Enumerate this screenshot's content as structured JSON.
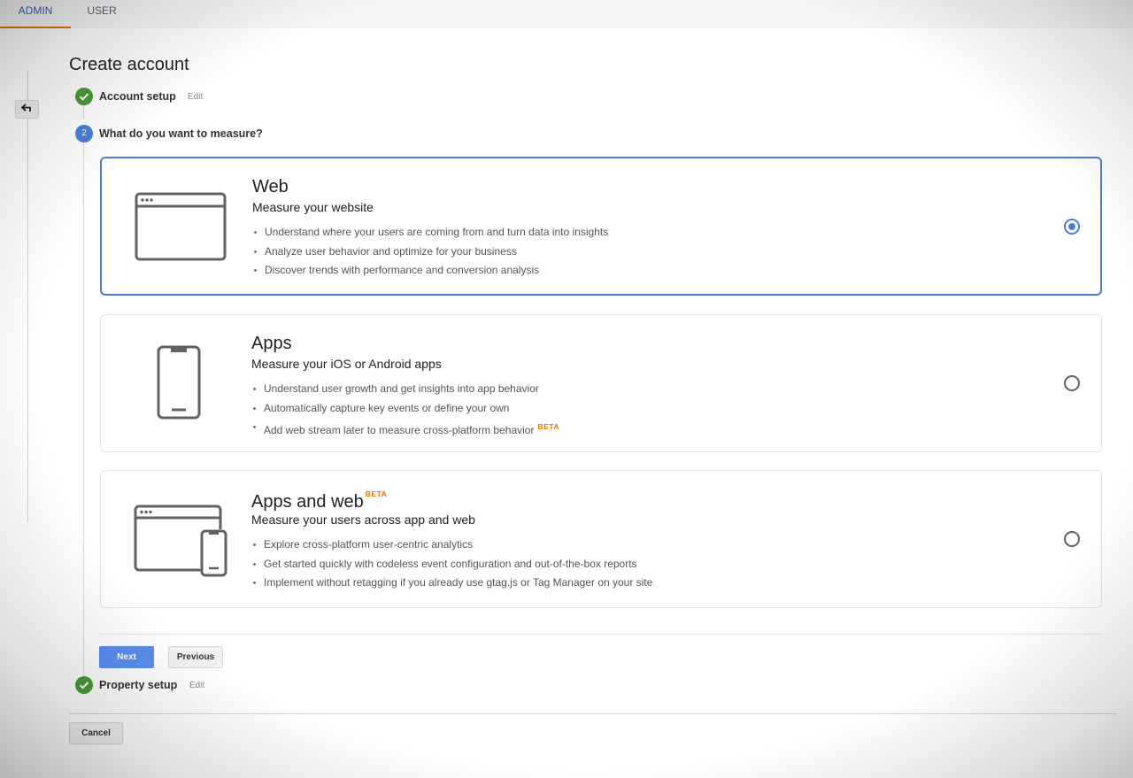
{
  "tabs": [
    {
      "label": "ADMIN",
      "active": true
    },
    {
      "label": "USER",
      "active": false
    }
  ],
  "back_button": {
    "icon": "back-arrow-icon",
    "glyph": "↩"
  },
  "page_title": "Create account",
  "steps": [
    {
      "number": "1",
      "label": "Account setup",
      "status": "complete",
      "edit_label": "Edit",
      "icon": "check-icon"
    },
    {
      "number": "2",
      "label": "What do you want to measure?",
      "status": "current"
    },
    {
      "number": "3",
      "label": "Property setup",
      "status": "complete",
      "edit_label": "Edit",
      "icon": "check-icon"
    }
  ],
  "options": [
    {
      "id": "web",
      "title": "Web",
      "subtitle": "Measure your website",
      "icon": "browser-window-icon",
      "selected": true,
      "bullets": [
        "Understand where your users are coming from and turn data into insights",
        "Analyze user behavior and optimize for your business",
        "Discover trends with performance and conversion analysis"
      ]
    },
    {
      "id": "apps",
      "title": "Apps",
      "subtitle": "Measure your iOS or Android apps",
      "icon": "smartphone-icon",
      "selected": false,
      "bullets": [
        "Understand user growth and get insights into app behavior",
        "Automatically capture key events or define your own",
        "Add web stream later to measure cross-platform behavior"
      ],
      "bullet_badge": "BETA"
    },
    {
      "id": "apps-and-web",
      "title": "Apps and web",
      "title_badge": "BETA",
      "subtitle": "Measure your users across app and web",
      "icon": "browser-and-phone-icon",
      "selected": false,
      "bullets": [
        "Explore cross-platform user-centric analytics",
        "Get started quickly with codeless event configuration and out-of-the-box reports",
        "Implement without retagging if you already use gtag.js or Tag Manager on your site"
      ]
    }
  ],
  "buttons": {
    "next": "Next",
    "previous": "Previous",
    "cancel": "Cancel"
  },
  "colors": {
    "accent": "#4a7fd4",
    "primary_button": "#5b8ef0",
    "success": "#4a9a3a",
    "beta": "#e37400",
    "active_tab_underline": "#e37400"
  }
}
